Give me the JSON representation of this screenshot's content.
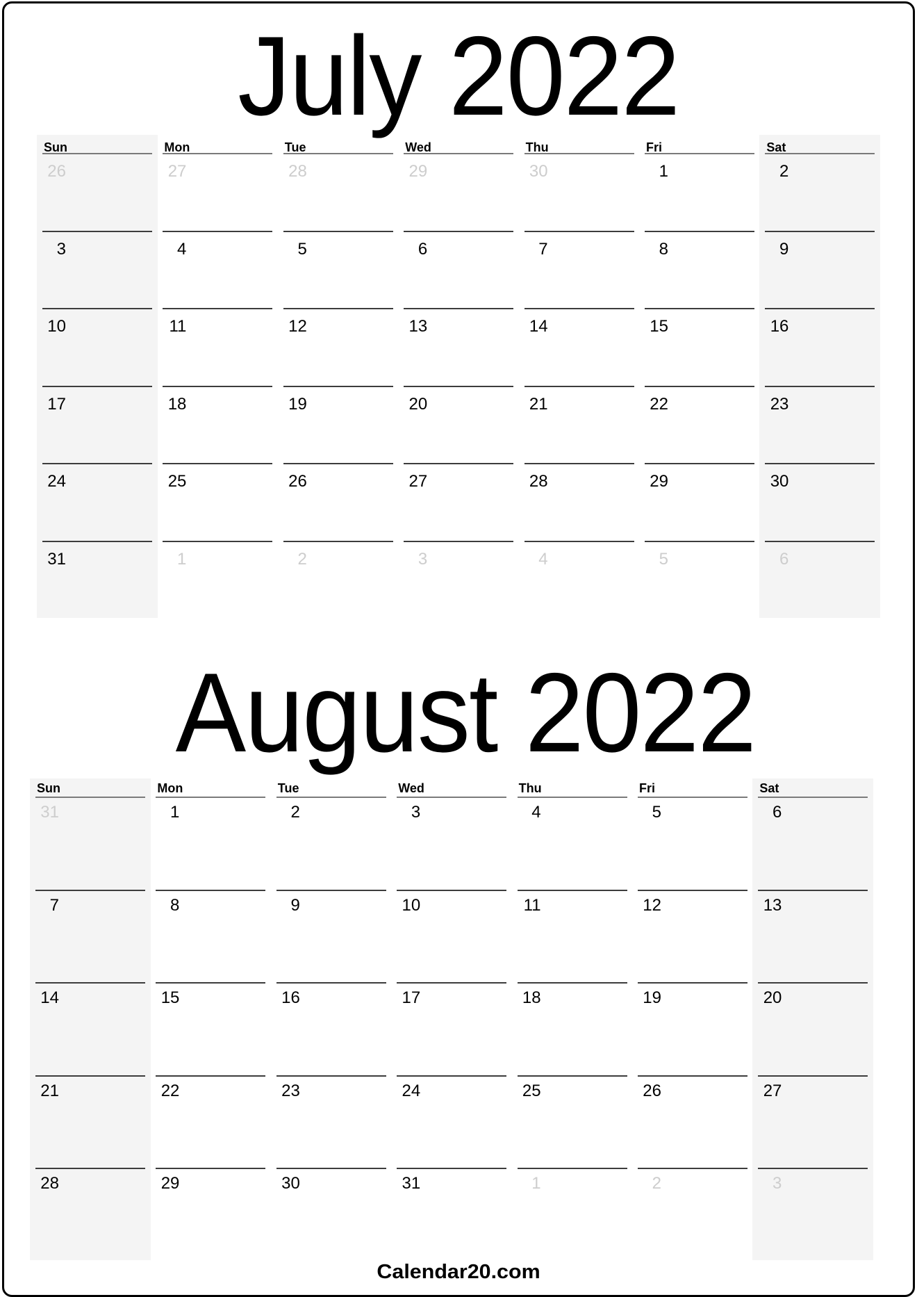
{
  "months": [
    {
      "title": "July 2022",
      "weekdays": [
        "Sun",
        "Mon",
        "Tue",
        "Wed",
        "Thu",
        "Fri",
        "Sat"
      ],
      "weeks": [
        [
          {
            "d": "26",
            "out": true
          },
          {
            "d": "27",
            "out": true
          },
          {
            "d": "28",
            "out": true
          },
          {
            "d": "29",
            "out": true
          },
          {
            "d": "30",
            "out": true
          },
          {
            "d": "1",
            "out": false
          },
          {
            "d": "2",
            "out": false
          }
        ],
        [
          {
            "d": "3",
            "out": false
          },
          {
            "d": "4",
            "out": false
          },
          {
            "d": "5",
            "out": false
          },
          {
            "d": "6",
            "out": false
          },
          {
            "d": "7",
            "out": false
          },
          {
            "d": "8",
            "out": false
          },
          {
            "d": "9",
            "out": false
          }
        ],
        [
          {
            "d": "10",
            "out": false
          },
          {
            "d": "11",
            "out": false
          },
          {
            "d": "12",
            "out": false
          },
          {
            "d": "13",
            "out": false
          },
          {
            "d": "14",
            "out": false
          },
          {
            "d": "15",
            "out": false
          },
          {
            "d": "16",
            "out": false
          }
        ],
        [
          {
            "d": "17",
            "out": false
          },
          {
            "d": "18",
            "out": false
          },
          {
            "d": "19",
            "out": false
          },
          {
            "d": "20",
            "out": false
          },
          {
            "d": "21",
            "out": false
          },
          {
            "d": "22",
            "out": false
          },
          {
            "d": "23",
            "out": false
          }
        ],
        [
          {
            "d": "24",
            "out": false
          },
          {
            "d": "25",
            "out": false
          },
          {
            "d": "26",
            "out": false
          },
          {
            "d": "27",
            "out": false
          },
          {
            "d": "28",
            "out": false
          },
          {
            "d": "29",
            "out": false
          },
          {
            "d": "30",
            "out": false
          }
        ],
        [
          {
            "d": "31",
            "out": false
          },
          {
            "d": "1",
            "out": true
          },
          {
            "d": "2",
            "out": true
          },
          {
            "d": "3",
            "out": true
          },
          {
            "d": "4",
            "out": true
          },
          {
            "d": "5",
            "out": true
          },
          {
            "d": "6",
            "out": true
          }
        ]
      ]
    },
    {
      "title": "August 2022",
      "weekdays": [
        "Sun",
        "Mon",
        "Tue",
        "Wed",
        "Thu",
        "Fri",
        "Sat"
      ],
      "weeks": [
        [
          {
            "d": "31",
            "out": true
          },
          {
            "d": "1",
            "out": false
          },
          {
            "d": "2",
            "out": false
          },
          {
            "d": "3",
            "out": false
          },
          {
            "d": "4",
            "out": false
          },
          {
            "d": "5",
            "out": false
          },
          {
            "d": "6",
            "out": false
          }
        ],
        [
          {
            "d": "7",
            "out": false
          },
          {
            "d": "8",
            "out": false
          },
          {
            "d": "9",
            "out": false
          },
          {
            "d": "10",
            "out": false
          },
          {
            "d": "11",
            "out": false
          },
          {
            "d": "12",
            "out": false
          },
          {
            "d": "13",
            "out": false
          }
        ],
        [
          {
            "d": "14",
            "out": false
          },
          {
            "d": "15",
            "out": false
          },
          {
            "d": "16",
            "out": false
          },
          {
            "d": "17",
            "out": false
          },
          {
            "d": "18",
            "out": false
          },
          {
            "d": "19",
            "out": false
          },
          {
            "d": "20",
            "out": false
          }
        ],
        [
          {
            "d": "21",
            "out": false
          },
          {
            "d": "22",
            "out": false
          },
          {
            "d": "23",
            "out": false
          },
          {
            "d": "24",
            "out": false
          },
          {
            "d": "25",
            "out": false
          },
          {
            "d": "26",
            "out": false
          },
          {
            "d": "27",
            "out": false
          }
        ],
        [
          {
            "d": "28",
            "out": false
          },
          {
            "d": "29",
            "out": false
          },
          {
            "d": "30",
            "out": false
          },
          {
            "d": "31",
            "out": false
          },
          {
            "d": "1",
            "out": true
          },
          {
            "d": "2",
            "out": true
          },
          {
            "d": "3",
            "out": true
          }
        ]
      ]
    }
  ],
  "footer": {
    "text": "Calendar20.com"
  },
  "colors": {
    "weekend_shade": "#f4f4f4",
    "out_of_month_text": "#cdcdcd",
    "text": "#000000"
  }
}
